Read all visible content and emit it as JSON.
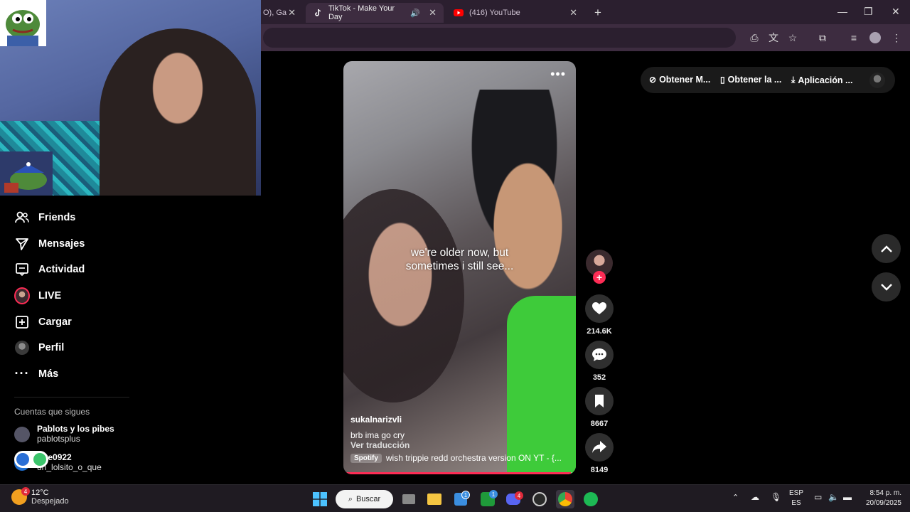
{
  "browser": {
    "tabs": [
      {
        "title": "O), Ga",
        "active": false
      },
      {
        "title": "TikTok - Make Your Day",
        "active": true
      },
      {
        "title": "(416) YouTube",
        "active": false
      }
    ],
    "new_tab_label": "+"
  },
  "sidebar": {
    "items": [
      {
        "label": "Friends",
        "icon": "friends-icon"
      },
      {
        "label": "Mensajes",
        "icon": "messages-icon"
      },
      {
        "label": "Actividad",
        "icon": "activity-icon"
      },
      {
        "label": "LIVE",
        "icon": "live-icon"
      },
      {
        "label": "Cargar",
        "icon": "upload-icon"
      },
      {
        "label": "Perfil",
        "icon": "profile-icon"
      },
      {
        "label": "Más",
        "icon": "more-icon"
      }
    ],
    "following_title": "Cuentas que sigues",
    "accounts": [
      {
        "name": "Pablots y los pibes",
        "handle": "pablotsplus"
      },
      {
        "name": "arte0922",
        "handle": "un_lolsito_o_que"
      }
    ]
  },
  "video": {
    "overlay_text_line1": "we're older now, but",
    "overlay_text_line2": "sometimes i still see...",
    "author": "sukalnarizvli",
    "description": "brb ima go cry",
    "translate_label": "Ver traducción",
    "music_tag": "Spotify",
    "music_text": "wish trippie redd orchestra version ON YT - {...",
    "progress": 0.98
  },
  "actions": {
    "likes": "214.6K",
    "comments": "352",
    "saves": "8667",
    "shares": "8149"
  },
  "topbar": {
    "pill1": "Obtener M...",
    "pill2": "Obtener la ...",
    "pill3": "Aplicación ..."
  },
  "taskbar": {
    "weather_temp": "12°C",
    "weather_desc": "Despejado",
    "weather_badge": "4",
    "search_label": "Buscar",
    "lang_top": "ESP",
    "lang_bottom": "ES",
    "time": "8:54 p. m.",
    "date": "20/09/2025",
    "badges": {
      "store": "1",
      "xbox": "1",
      "discord": "4"
    }
  },
  "colors": {
    "accent": "#fe2c55",
    "chrome_tabstrip": "#2b1f2f",
    "chrome_toolbar": "#3d2c40"
  }
}
